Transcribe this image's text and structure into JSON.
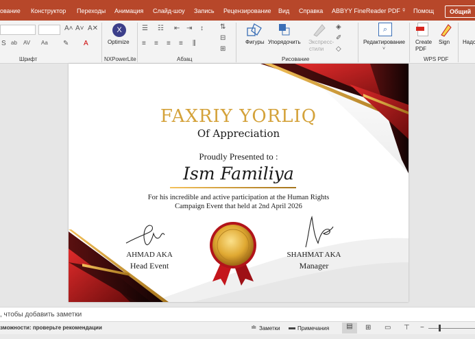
{
  "menubar": {
    "tabs": [
      "ование",
      "Конструктор",
      "Переходы",
      "Анимация",
      "Слайд-шоу",
      "Запись",
      "Рецензирование",
      "Вид",
      "Справка",
      "ABBYY FineReader PDF"
    ],
    "help_label": "Помощ",
    "share_label": "Общий"
  },
  "ribbon": {
    "group_labels": {
      "font": "Шрифт",
      "nxpowerlite": "NXPowerLite",
      "paragraph": "Абзац",
      "drawing": "Рисование",
      "wps_pdf": "WPS PDF"
    },
    "optimize_label": "Optimize",
    "shapes_label": "Фигуры",
    "arrange_label": "Упорядочить",
    "express_label": "Экспресс-",
    "styles_label": "стили",
    "editing_label": "Редактирование",
    "create_pdf_label": "Create PDF",
    "sign_label": "Sign",
    "addins_label": "Надс"
  },
  "slide": {
    "title": "FAXRIY YORLIQ",
    "subtitle": "Of Appreciation",
    "presented": "Proudly Presented to :",
    "recipient": "Ism Familiya",
    "body_line1": "For his incredible and active participation at the Human Rights",
    "body_line2": "Campaign Event that held at 2nd April 2026",
    "left_name": "AHMAD AKA",
    "left_role": "Head Event",
    "right_name": "SHAHMAT AKA",
    "right_role": "Manager"
  },
  "notes": {
    "placeholder": ", чтобы добавить заметки"
  },
  "status": {
    "accessibility": "зможности: проверьте рекомендации",
    "notes_button": "Заметки",
    "comments_button": "Примечания"
  },
  "colors": {
    "accent": "#b7472a",
    "gold": "#d4a23a",
    "red": "#c4161c",
    "dark": "#2a0a0a"
  }
}
